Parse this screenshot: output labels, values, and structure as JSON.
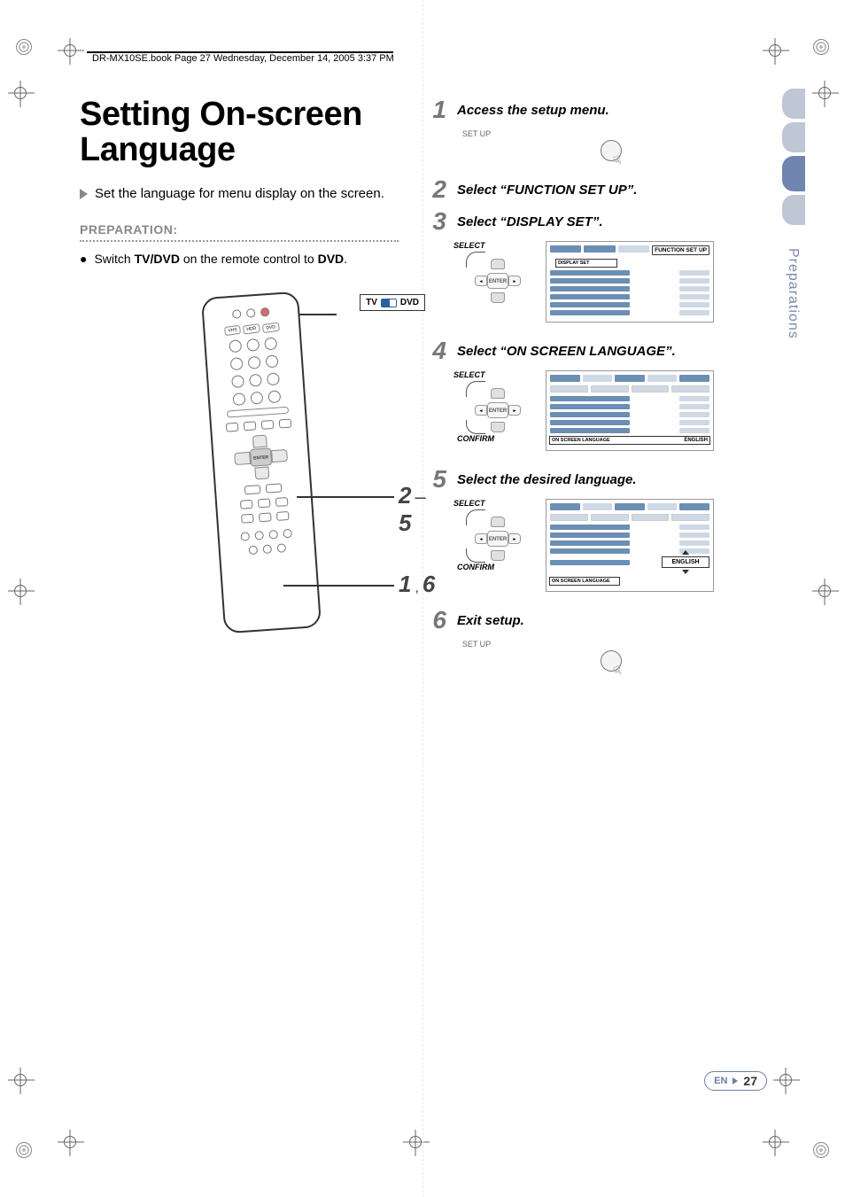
{
  "header_line": "DR-MX10SE.book  Page 27  Wednesday, December 14, 2005  3:37 PM",
  "title": "Setting On-screen Language",
  "intro": "Set the language for menu display on the screen.",
  "preparation_heading": "PREPARATION:",
  "preparation_item_prefix": "Switch ",
  "preparation_item_bold1": "TV/DVD",
  "preparation_item_mid": " on the remote control to ",
  "preparation_item_bold2": "DVD",
  "preparation_item_suffix": ".",
  "remote": {
    "tv_label": "TV",
    "dvd_label": "DVD",
    "enter_label": "ENTER",
    "vhs_label": "VHS",
    "hdd_label": "HDD",
    "dvd2_label": "DVD",
    "callout_right_a": "2",
    "callout_right_sep1": "–",
    "callout_right_b": "5",
    "callout_right_c": "1",
    "callout_right_sep2": ",",
    "callout_right_d": "6"
  },
  "setup_label": "SET UP",
  "dpad": {
    "select_label": "SELECT",
    "confirm_label": "CONFIRM",
    "enter": "ENTER",
    "left": "◄",
    "right": "►",
    "up": "▲",
    "down": "▼"
  },
  "steps": [
    {
      "num": "1",
      "text": "Access the setup menu."
    },
    {
      "num": "2",
      "prefix": "Select “",
      "menu": "FUNCTION SET UP",
      "suffix": "”."
    },
    {
      "num": "3",
      "prefix": "Select “",
      "menu": "DISPLAY SET",
      "suffix": "”."
    },
    {
      "num": "4",
      "prefix": "Select “",
      "menu": "ON SCREEN LANGUAGE",
      "suffix": "”."
    },
    {
      "num": "5",
      "text": "Select the desired language."
    },
    {
      "num": "6",
      "text": "Exit setup."
    }
  ],
  "menu3": {
    "tab_highlight": "FUNCTION SET UP",
    "row_highlight": "DISPLAY SET"
  },
  "menu4": {
    "row_label": "ON SCREEN LANGUAGE",
    "row_value": "ENGLISH"
  },
  "menu5": {
    "row_label": "ON SCREEN LANGUAGE",
    "dropdown_value": "ENGLISH"
  },
  "side_section": "Preparations",
  "footer": {
    "lang": "EN",
    "page": "27"
  }
}
